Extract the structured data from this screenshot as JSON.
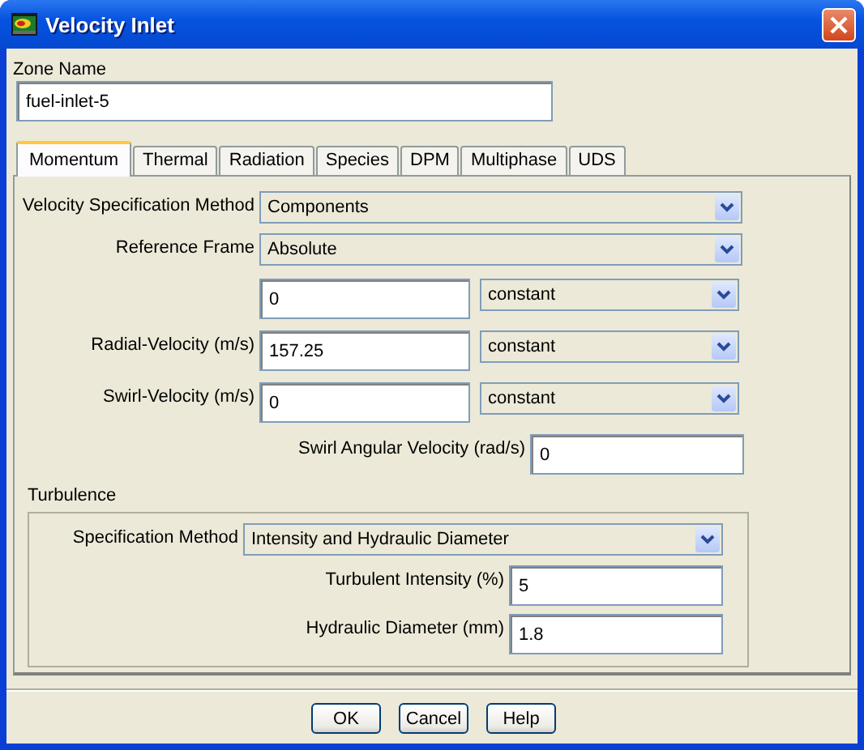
{
  "window": {
    "title": "Velocity Inlet"
  },
  "zone_name": {
    "label": "Zone Name",
    "value": "fuel-inlet-5"
  },
  "tabs": [
    {
      "label": "Momentum",
      "selected": true
    },
    {
      "label": "Thermal",
      "selected": false
    },
    {
      "label": "Radiation",
      "selected": false
    },
    {
      "label": "Species",
      "selected": false
    },
    {
      "label": "DPM",
      "selected": false
    },
    {
      "label": "Multiphase",
      "selected": false
    },
    {
      "label": "UDS",
      "selected": false
    }
  ],
  "momentum": {
    "rows": [
      {
        "kind": "dropdown",
        "label": "Velocity Specification Method",
        "value": "Components"
      },
      {
        "kind": "dropdown",
        "label": "Reference Frame",
        "value": "Absolute"
      },
      {
        "kind": "value-profile",
        "value": "0",
        "profile": "constant"
      },
      {
        "kind": "value-profile",
        "label": "Radial-Velocity (m/s)",
        "value": "157.25",
        "profile": "constant"
      },
      {
        "kind": "value-profile",
        "label": "Swirl-Velocity (m/s)",
        "value": "0",
        "profile": "constant"
      },
      {
        "kind": "input",
        "label": "Swirl Angular Velocity (rad/s)",
        "value": "0"
      }
    ]
  },
  "turbulence": {
    "title": "Turbulence",
    "rows": [
      {
        "kind": "dropdown",
        "label": "Specification Method",
        "value": "Intensity and Hydraulic Diameter"
      },
      {
        "kind": "input",
        "label": "Turbulent Intensity (%)",
        "value": "5"
      },
      {
        "kind": "input",
        "label": "Hydraulic Diameter (mm)",
        "value": "1.8"
      }
    ]
  },
  "buttons": [
    "OK",
    "Cancel",
    "Help"
  ]
}
